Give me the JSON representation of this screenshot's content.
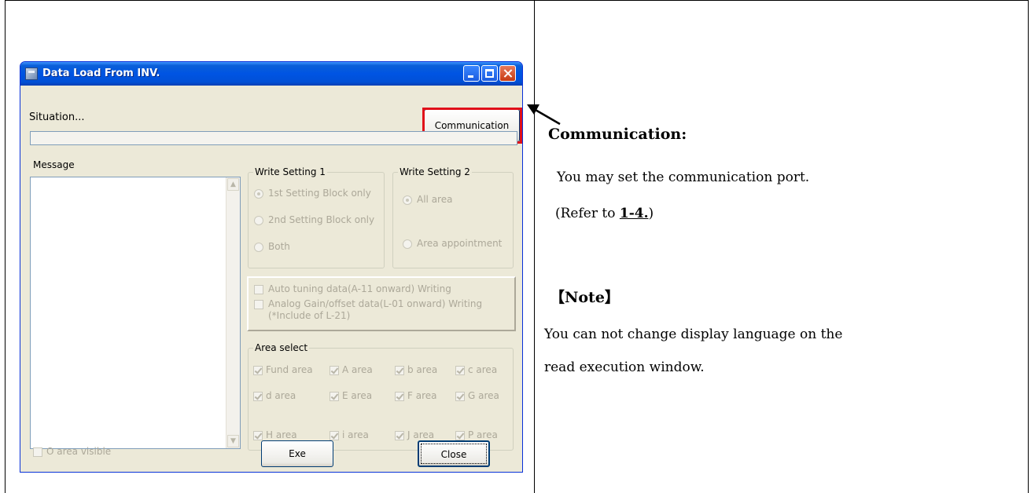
{
  "window": {
    "title": "Data Load From INV.",
    "situation_label": "Situation...",
    "communication_button": "Communication",
    "message_label": "Message",
    "write_setting_1": {
      "label": "Write Setting 1",
      "options": [
        "1st Setting Block only",
        "2nd Setting Block only",
        "Both"
      ],
      "selected": "1st Setting Block only"
    },
    "write_setting_2": {
      "label": "Write Setting 2",
      "options": [
        "All area",
        "Area appointment"
      ],
      "selected": "All area"
    },
    "checkboxes": {
      "auto_tuning": "Auto tuning data(A-11 onward) Writing",
      "analog_gain_line1": "Analog Gain/offset data(L-01 onward) Writing",
      "analog_gain_line2": "(*Include of L-21)"
    },
    "area_select": {
      "label": "Area select",
      "areas": [
        "Fund area",
        "A area",
        "b area",
        "c area",
        "d area",
        "E area",
        "F area",
        "G area",
        "H area",
        "i area",
        "J area",
        "P area"
      ]
    },
    "o_area_visible": "O area visible",
    "exe_button": "Exe",
    "close_button": "Close"
  },
  "explanation": {
    "heading": "Communication:",
    "line1": "You may set the communication port.",
    "refer_prefix": "(Refer to ",
    "refer_link": "1-4.",
    "refer_suffix": ")",
    "note_heading": "【Note】",
    "note_line1": "You can not change display language on the",
    "note_line2": "read execution window."
  },
  "colors": {
    "highlight": "#e0101a",
    "titlebar": "#0054e3",
    "window_bg": "#ece9d8"
  }
}
